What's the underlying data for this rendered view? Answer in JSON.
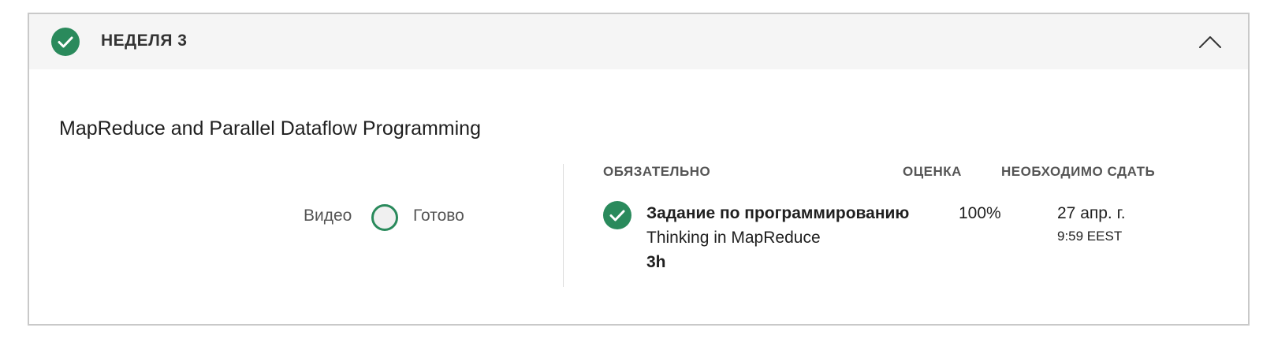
{
  "week": {
    "title": "НЕДЕЛЯ 3",
    "completed": true
  },
  "module": {
    "title": "MapReduce and Parallel Dataflow Programming"
  },
  "progress": {
    "video_label": "Видео",
    "status_label": "Готово"
  },
  "table": {
    "headers": {
      "required": "ОБЯЗАТЕЛЬНО",
      "grade": "ОЦЕНКА",
      "due": "НЕОБХОДИМО СДАТЬ"
    },
    "rows": [
      {
        "type": "Задание по программированию",
        "name": "Thinking in MapReduce",
        "duration": "3h",
        "grade": "100%",
        "due_date": "27 апр. г.",
        "due_time": "9:59 EEST",
        "completed": true
      }
    ]
  },
  "colors": {
    "accent": "#2a8a5c",
    "header_bg": "#f5f5f5",
    "border": "#c9c9c9"
  },
  "icons": {
    "header_status": "check-circle-icon",
    "collapse": "chevron-up-icon",
    "row_status": "check-circle-icon",
    "video_status": "empty-ring-icon"
  }
}
